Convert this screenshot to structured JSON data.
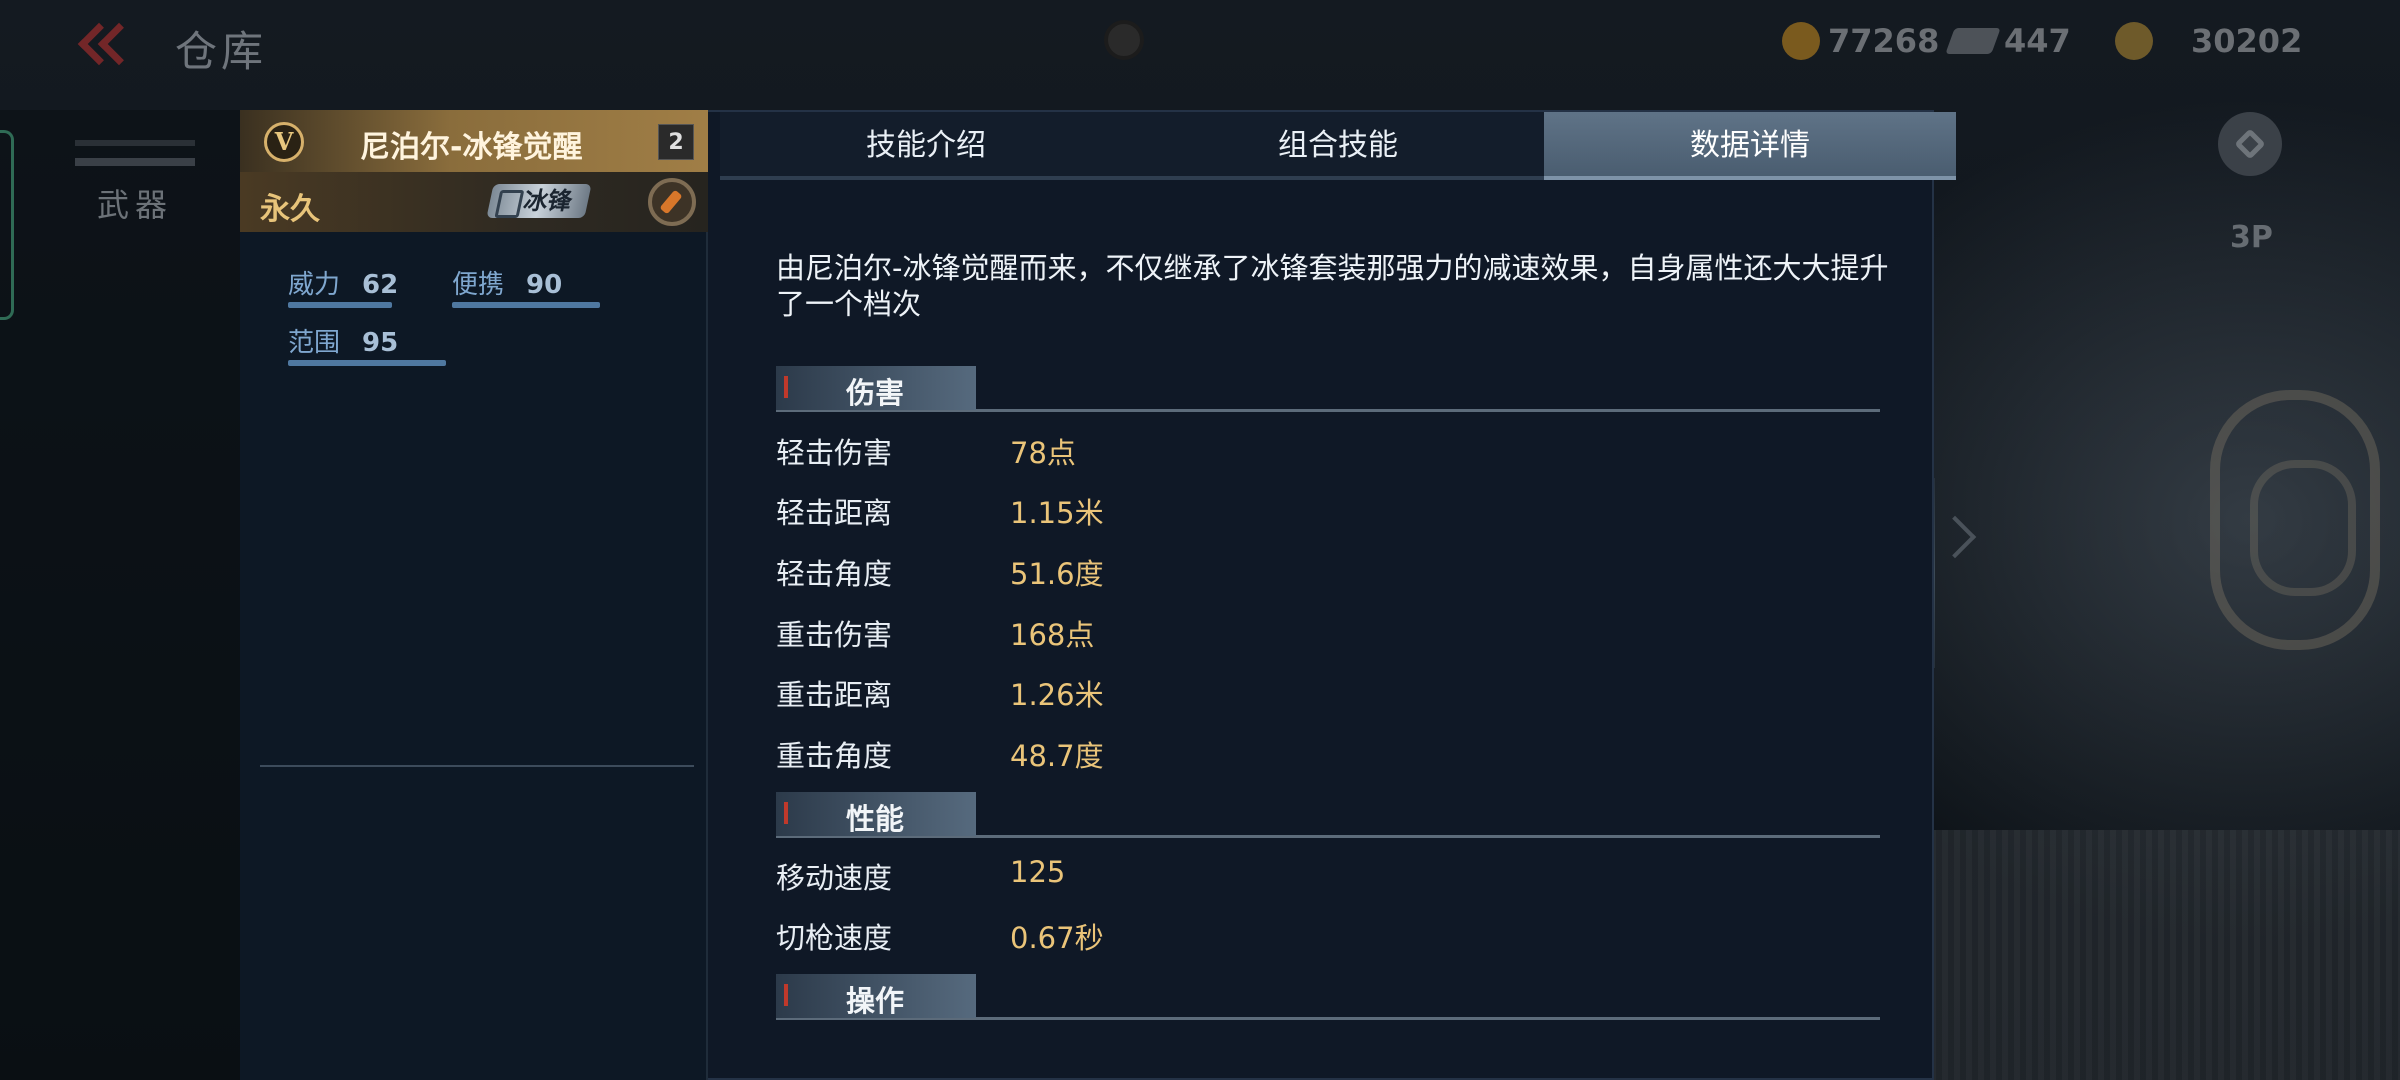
{
  "topbar": {
    "title": "仓库",
    "currencies": [
      {
        "icon": "gold-coin-icon",
        "value": "77268"
      },
      {
        "icon": "diamond-icon",
        "value": "447"
      },
      {
        "icon": "coin-icon",
        "value": "30202"
      }
    ]
  },
  "sidebar": {
    "category_label": "武器"
  },
  "camera_view": {
    "label": "3P"
  },
  "weapon": {
    "rank_letter": "V",
    "name": "尼泊尔-冰锋觉醒",
    "level": "2",
    "duration": "永久",
    "series": "冰锋",
    "stats": [
      {
        "label": "威力",
        "value": "62"
      },
      {
        "label": "便携",
        "value": "90"
      },
      {
        "label": "范围",
        "value": "95"
      }
    ]
  },
  "tabs": [
    {
      "label": "技能介绍",
      "active": false
    },
    {
      "label": "组合技能",
      "active": false
    },
    {
      "label": "数据详情",
      "active": true
    }
  ],
  "details": {
    "description": "由尼泊尔-冰锋觉醒而来，不仅继承了冰锋套装那强力的减速效果，自身属性还大大提升了一个档次",
    "sections": [
      {
        "title": "伤害",
        "rows": [
          {
            "label": "轻击伤害",
            "value": "78点"
          },
          {
            "label": "轻击距离",
            "value": "1.15米"
          },
          {
            "label": "轻击角度",
            "value": "51.6度"
          },
          {
            "label": "重击伤害",
            "value": "168点"
          },
          {
            "label": "重击距离",
            "value": "1.26米"
          },
          {
            "label": "重击角度",
            "value": "48.7度"
          }
        ]
      },
      {
        "title": "性能",
        "rows": [
          {
            "label": "移动速度",
            "value": "125"
          },
          {
            "label": "切枪速度",
            "value": "0.67秒"
          }
        ]
      },
      {
        "title": "操作",
        "rows": []
      }
    ]
  },
  "colors": {
    "accent_gold": "#eac479",
    "stat_blue": "#7fa7cf",
    "tab_active": "#5f7387",
    "name_bar_gold": "#a07e46"
  }
}
